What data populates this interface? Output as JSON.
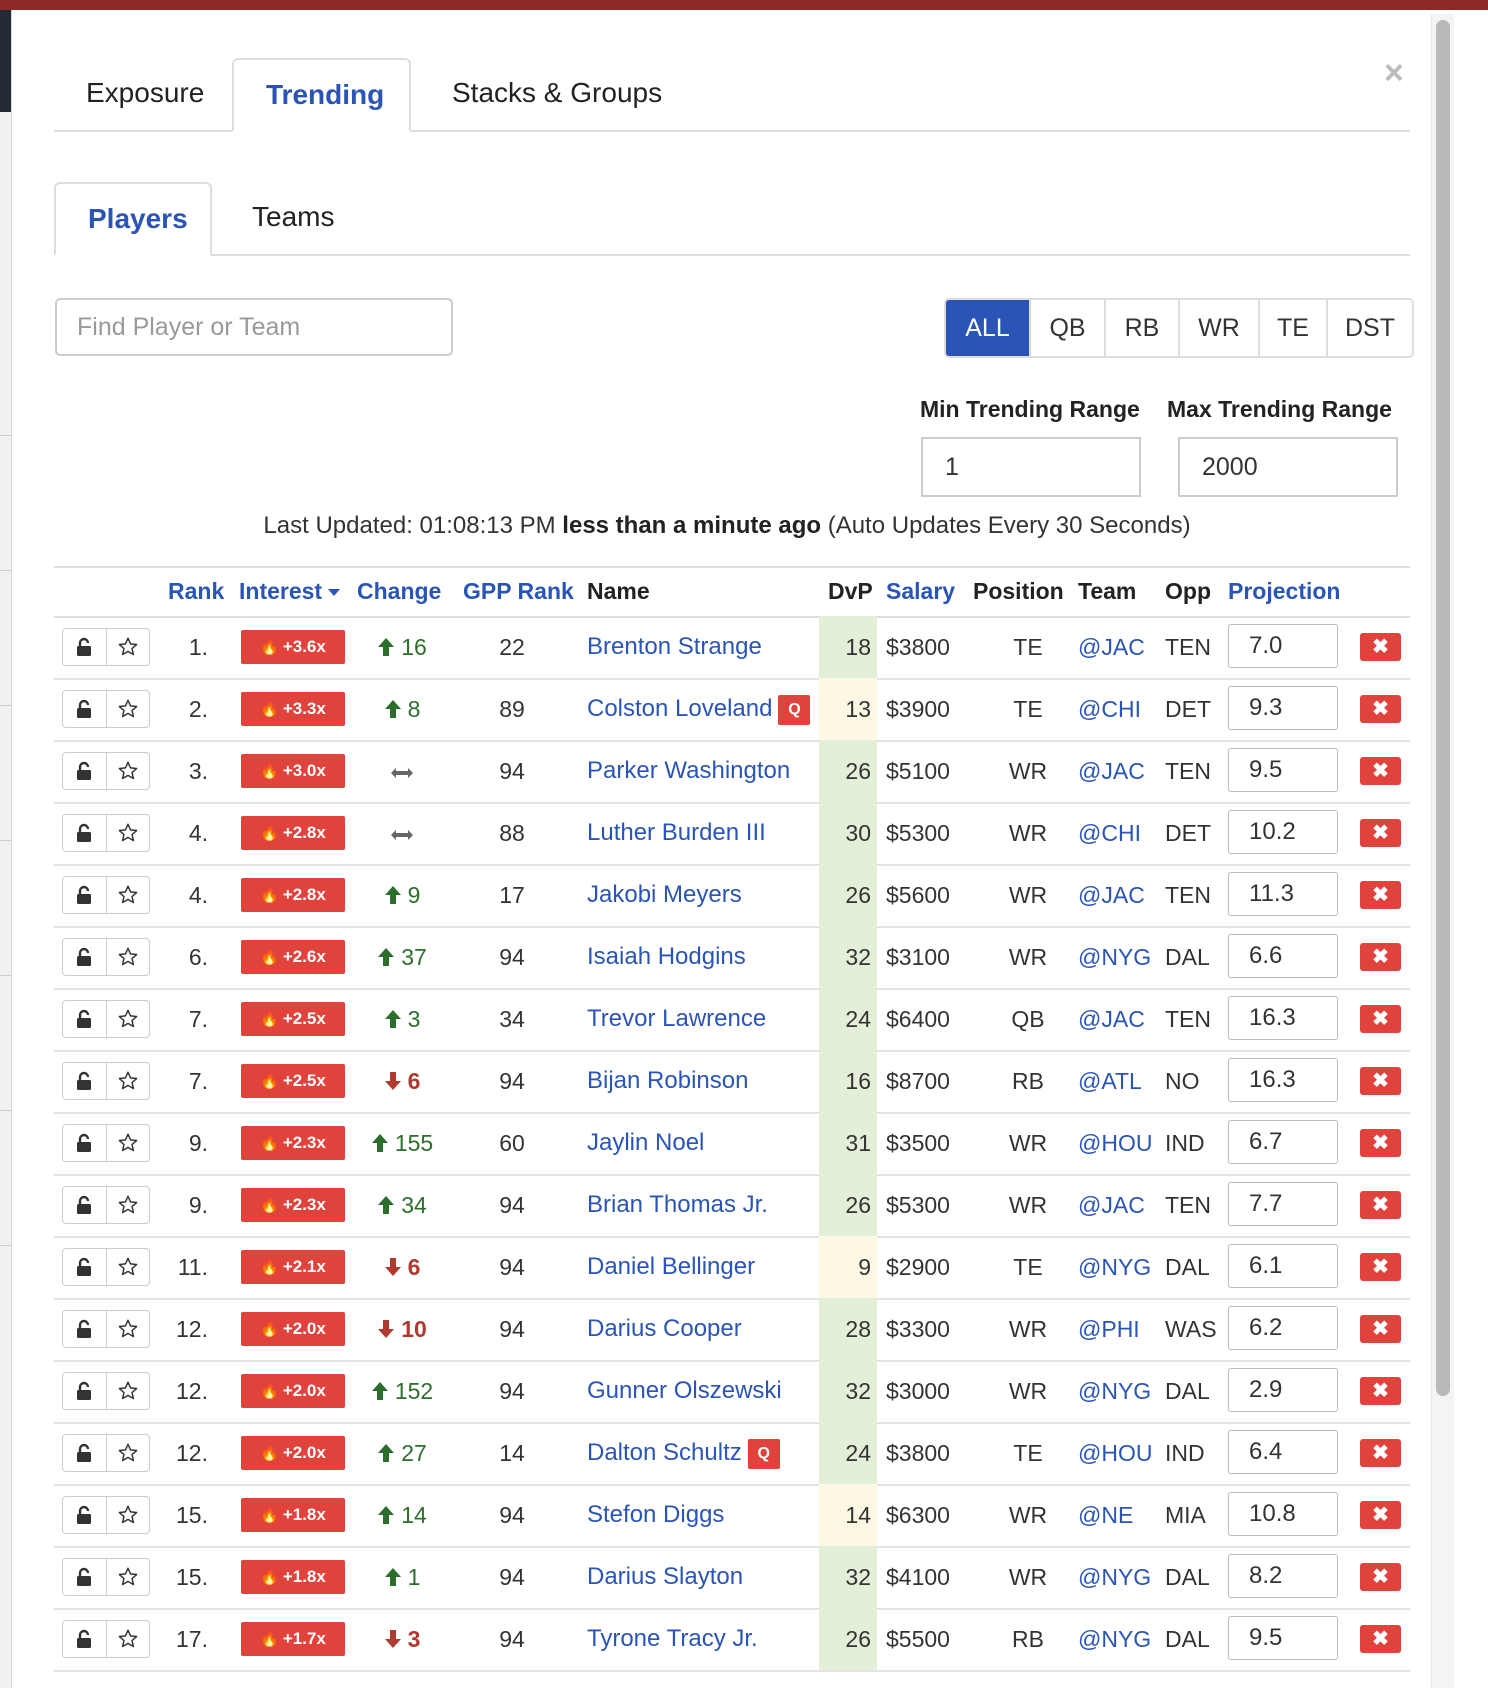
{
  "main_tabs": [
    {
      "label": "Exposure",
      "active": false
    },
    {
      "label": "Trending",
      "active": true
    },
    {
      "label": "Stacks & Groups",
      "active": false
    }
  ],
  "close_label": "×",
  "sub_tabs": [
    {
      "label": "Players",
      "active": true
    },
    {
      "label": "Teams",
      "active": false
    }
  ],
  "search": {
    "placeholder": "Find Player or Team",
    "value": ""
  },
  "position_filters": [
    {
      "label": "ALL",
      "active": true
    },
    {
      "label": "QB",
      "active": false
    },
    {
      "label": "RB",
      "active": false
    },
    {
      "label": "WR",
      "active": false
    },
    {
      "label": "TE",
      "active": false
    },
    {
      "label": "DST",
      "active": false
    }
  ],
  "range": {
    "min_label": "Min Trending Range",
    "min_value": "1",
    "max_label": "Max Trending Range",
    "max_value": "2000"
  },
  "updated": {
    "prefix": "Last Updated: 01:08:13 PM",
    "relative": "less than a minute ago",
    "suffix": "(Auto Updates Every 30 Seconds)"
  },
  "columns": {
    "rank": "Rank",
    "interest": "Interest",
    "change": "Change",
    "gpp_rank": "GPP Rank",
    "name": "Name",
    "dvp": "DvP",
    "salary": "Salary",
    "position": "Position",
    "team": "Team",
    "opp": "Opp",
    "projection": "Projection"
  },
  "colors": {
    "accent": "#2a55b6",
    "badge_red": "#e0423c",
    "dvp_green": "#e3efd9",
    "dvp_yellow": "#fdf8e4",
    "change_up": "#2c6e2c",
    "change_down": "#b03a30"
  },
  "rows": [
    {
      "rank": "1.",
      "interest": "+3.6x",
      "change_dir": "up",
      "change": "16",
      "gpp_rank": "22",
      "name": "Brenton Strange",
      "tag": "",
      "dvp": "18",
      "dvp_tone": "green",
      "salary": "$3800",
      "position": "TE",
      "team": "@JAC",
      "opp": "TEN",
      "projection": "7.0"
    },
    {
      "rank": "2.",
      "interest": "+3.3x",
      "change_dir": "up",
      "change": "8",
      "gpp_rank": "89",
      "name": "Colston Loveland",
      "tag": "Q",
      "dvp": "13",
      "dvp_tone": "yellow",
      "salary": "$3900",
      "position": "TE",
      "team": "@CHI",
      "opp": "DET",
      "projection": "9.3"
    },
    {
      "rank": "3.",
      "interest": "+3.0x",
      "change_dir": "flat",
      "change": "",
      "gpp_rank": "94",
      "name": "Parker Washington",
      "tag": "",
      "dvp": "26",
      "dvp_tone": "green",
      "salary": "$5100",
      "position": "WR",
      "team": "@JAC",
      "opp": "TEN",
      "projection": "9.5"
    },
    {
      "rank": "4.",
      "interest": "+2.8x",
      "change_dir": "flat",
      "change": "",
      "gpp_rank": "88",
      "name": "Luther Burden III",
      "tag": "",
      "dvp": "30",
      "dvp_tone": "green",
      "salary": "$5300",
      "position": "WR",
      "team": "@CHI",
      "opp": "DET",
      "projection": "10.2"
    },
    {
      "rank": "4.",
      "interest": "+2.8x",
      "change_dir": "up",
      "change": "9",
      "gpp_rank": "17",
      "name": "Jakobi Meyers",
      "tag": "",
      "dvp": "26",
      "dvp_tone": "green",
      "salary": "$5600",
      "position": "WR",
      "team": "@JAC",
      "opp": "TEN",
      "projection": "11.3"
    },
    {
      "rank": "6.",
      "interest": "+2.6x",
      "change_dir": "up",
      "change": "37",
      "gpp_rank": "94",
      "name": "Isaiah Hodgins",
      "tag": "",
      "dvp": "32",
      "dvp_tone": "green",
      "salary": "$3100",
      "position": "WR",
      "team": "@NYG",
      "opp": "DAL",
      "projection": "6.6"
    },
    {
      "rank": "7.",
      "interest": "+2.5x",
      "change_dir": "up",
      "change": "3",
      "gpp_rank": "34",
      "name": "Trevor Lawrence",
      "tag": "",
      "dvp": "24",
      "dvp_tone": "green",
      "salary": "$6400",
      "position": "QB",
      "team": "@JAC",
      "opp": "TEN",
      "projection": "16.3"
    },
    {
      "rank": "7.",
      "interest": "+2.5x",
      "change_dir": "down",
      "change": "6",
      "gpp_rank": "94",
      "name": "Bijan Robinson",
      "tag": "",
      "dvp": "16",
      "dvp_tone": "green",
      "salary": "$8700",
      "position": "RB",
      "team": "@ATL",
      "opp": "NO",
      "projection": "16.3"
    },
    {
      "rank": "9.",
      "interest": "+2.3x",
      "change_dir": "up",
      "change": "155",
      "gpp_rank": "60",
      "name": "Jaylin Noel",
      "tag": "",
      "dvp": "31",
      "dvp_tone": "green",
      "salary": "$3500",
      "position": "WR",
      "team": "@HOU",
      "opp": "IND",
      "projection": "6.7"
    },
    {
      "rank": "9.",
      "interest": "+2.3x",
      "change_dir": "up",
      "change": "34",
      "gpp_rank": "94",
      "name": "Brian Thomas Jr.",
      "tag": "",
      "dvp": "26",
      "dvp_tone": "green",
      "salary": "$5300",
      "position": "WR",
      "team": "@JAC",
      "opp": "TEN",
      "projection": "7.7"
    },
    {
      "rank": "11.",
      "interest": "+2.1x",
      "change_dir": "down",
      "change": "6",
      "gpp_rank": "94",
      "name": "Daniel Bellinger",
      "tag": "",
      "dvp": "9",
      "dvp_tone": "yellow",
      "salary": "$2900",
      "position": "TE",
      "team": "@NYG",
      "opp": "DAL",
      "projection": "6.1"
    },
    {
      "rank": "12.",
      "interest": "+2.0x",
      "change_dir": "down",
      "change": "10",
      "gpp_rank": "94",
      "name": "Darius Cooper",
      "tag": "",
      "dvp": "28",
      "dvp_tone": "green",
      "salary": "$3300",
      "position": "WR",
      "team": "@PHI",
      "opp": "WAS",
      "projection": "6.2"
    },
    {
      "rank": "12.",
      "interest": "+2.0x",
      "change_dir": "up",
      "change": "152",
      "gpp_rank": "94",
      "name": "Gunner Olszewski",
      "tag": "",
      "dvp": "32",
      "dvp_tone": "green",
      "salary": "$3000",
      "position": "WR",
      "team": "@NYG",
      "opp": "DAL",
      "projection": "2.9"
    },
    {
      "rank": "12.",
      "interest": "+2.0x",
      "change_dir": "up",
      "change": "27",
      "gpp_rank": "14",
      "name": "Dalton Schultz",
      "tag": "Q",
      "dvp": "24",
      "dvp_tone": "green",
      "salary": "$3800",
      "position": "TE",
      "team": "@HOU",
      "opp": "IND",
      "projection": "6.4"
    },
    {
      "rank": "15.",
      "interest": "+1.8x",
      "change_dir": "up",
      "change": "14",
      "gpp_rank": "94",
      "name": "Stefon Diggs",
      "tag": "",
      "dvp": "14",
      "dvp_tone": "yellow",
      "salary": "$6300",
      "position": "WR",
      "team": "@NE",
      "opp": "MIA",
      "projection": "10.8"
    },
    {
      "rank": "15.",
      "interest": "+1.8x",
      "change_dir": "up",
      "change": "1",
      "gpp_rank": "94",
      "name": "Darius Slayton",
      "tag": "",
      "dvp": "32",
      "dvp_tone": "green",
      "salary": "$4100",
      "position": "WR",
      "team": "@NYG",
      "opp": "DAL",
      "projection": "8.2"
    },
    {
      "rank": "17.",
      "interest": "+1.7x",
      "change_dir": "down",
      "change": "3",
      "gpp_rank": "94",
      "name": "Tyrone Tracy Jr.",
      "tag": "",
      "dvp": "26",
      "dvp_tone": "green",
      "salary": "$5500",
      "position": "RB",
      "team": "@NYG",
      "opp": "DAL",
      "projection": "9.5"
    }
  ]
}
